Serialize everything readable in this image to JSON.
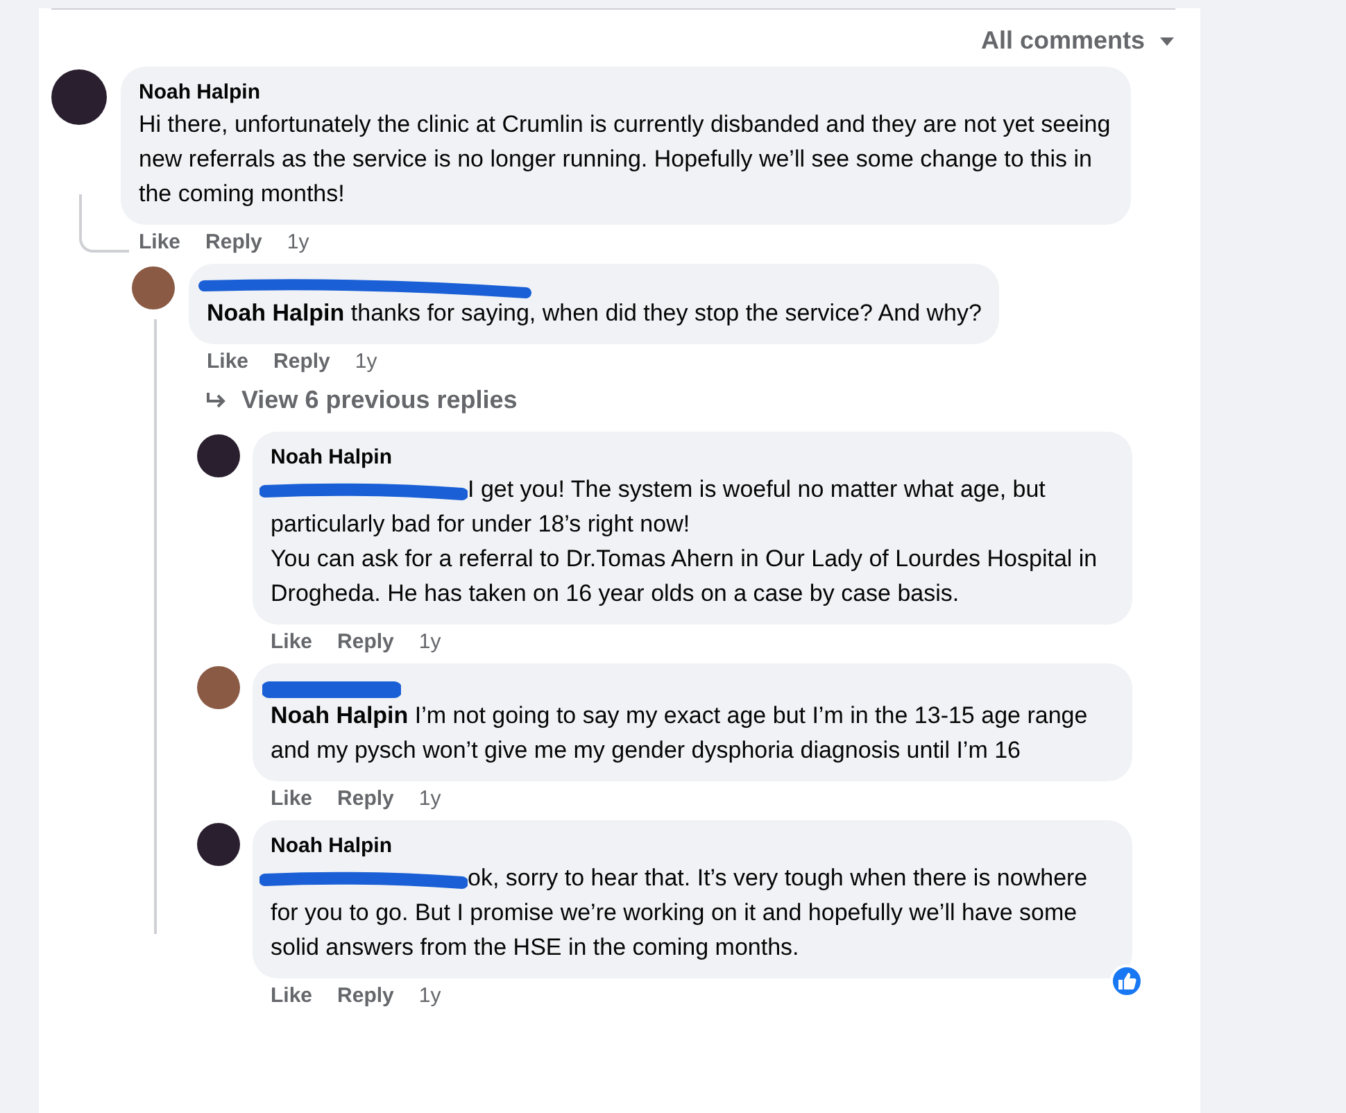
{
  "sort": {
    "label": "All comments"
  },
  "comments": [
    {
      "author": "Noah Halpin",
      "author_redacted": false,
      "prefix_redacted": false,
      "color": "#2a1f2e",
      "text": "Hi there, unfortunately the clinic at Crumlin is currently disbanded and they are not yet seeing new referrals as the service is no longer running. Hopefully we’ll see some change to this in the coming months!",
      "actions": [
        "Like",
        "Reply"
      ],
      "time": "1y",
      "replies": [
        {
          "author_redacted": true,
          "prefix_redacted": false,
          "color": "#8a5a44",
          "text": "**Noah Halpin** thanks for saying, when did they stop the service? And why?",
          "actions": [
            "Like",
            "Reply"
          ],
          "time": "1y",
          "more_replies": "View 6 previous replies",
          "replies": [
            {
              "author": "Noah Halpin",
              "author_redacted": false,
              "prefix_redacted": true,
              "color": "#2a1f2e",
              "text": "I get you! The system is woeful no matter what age, but particularly bad for under 18’s right now!\nYou can ask for a referral to Dr.Tomas Ahern in Our Lady of Lourdes Hospital in Drogheda. He has taken on 16 year olds on a case by case basis.",
              "actions": [
                "Like",
                "Reply"
              ],
              "time": "1y",
              "liked": false
            },
            {
              "author_redacted": true,
              "prefix_redacted": false,
              "color": "#8a5a44",
              "text": "**Noah Halpin** I’m not going to say my exact age but I’m in the 13-15 age range and my pysch won’t give me my gender dysphoria diagnosis until I’m 16",
              "actions": [
                "Like",
                "Reply"
              ],
              "time": "1y",
              "liked": false
            },
            {
              "author": "Noah Halpin",
              "author_redacted": false,
              "prefix_redacted": true,
              "color": "#2a1f2e",
              "text": "ok, sorry to hear that. It’s very tough when there is nowhere for you to go. But I promise we’re working on it and hopefully we’ll have some solid answers from the HSE in the coming months.",
              "actions": [
                "Like",
                "Reply"
              ],
              "time": "1y",
              "liked": true
            }
          ]
        }
      ]
    }
  ]
}
